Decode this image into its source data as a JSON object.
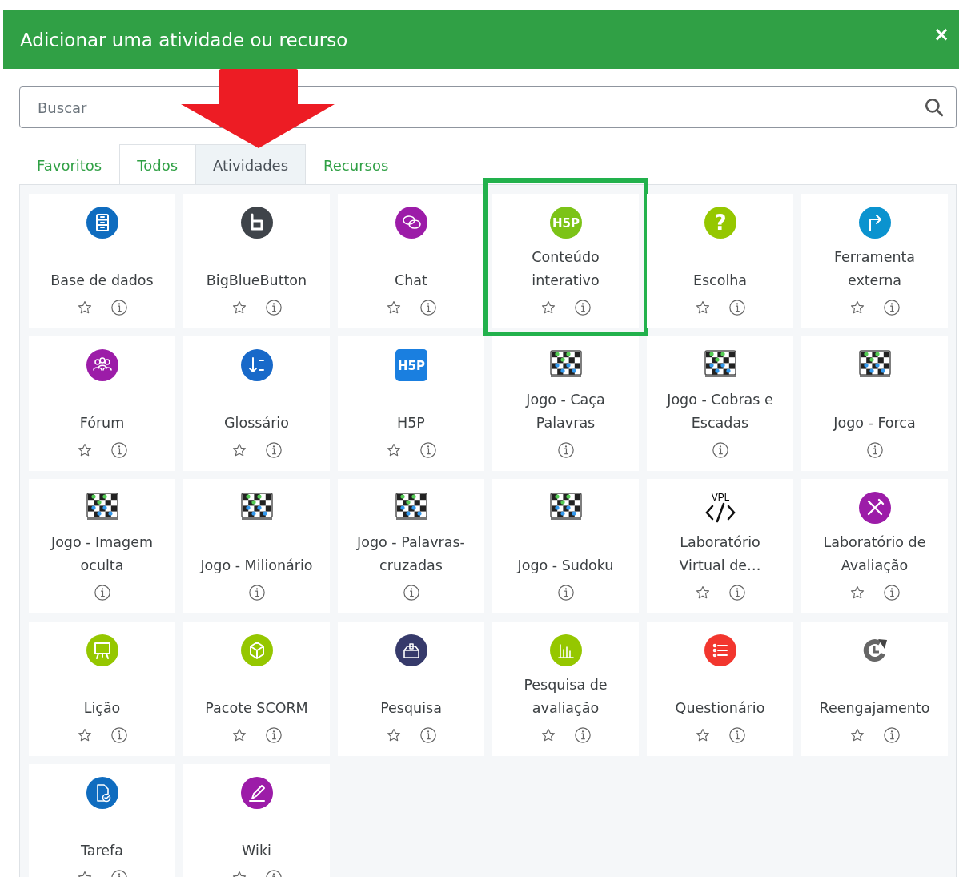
{
  "dialog": {
    "title": "Adicionar uma atividade ou recurso",
    "close": "×"
  },
  "search": {
    "placeholder": "Buscar"
  },
  "tabs": [
    {
      "label": "Favoritos",
      "selected": false,
      "bordered": false
    },
    {
      "label": "Todos",
      "selected": false,
      "bordered": true
    },
    {
      "label": "Atividades",
      "selected": true,
      "bordered": true
    },
    {
      "label": "Recursos",
      "selected": false,
      "bordered": false
    }
  ],
  "items": [
    {
      "name": "Base de dados",
      "kind": "circle",
      "color": "#0f6cbf",
      "star": true,
      "highlighted": false
    },
    {
      "name": "BigBlueButton",
      "kind": "circle",
      "color": "#3f444a",
      "star": true,
      "highlighted": false
    },
    {
      "name": "Chat",
      "kind": "circle",
      "color": "#9c1ca8",
      "star": true,
      "highlighted": false
    },
    {
      "name": "Conteúdo interativo",
      "kind": "circle",
      "icon_text": "H5P",
      "color": "#7cc317",
      "star": true,
      "highlighted": true
    },
    {
      "name": "Escolha",
      "kind": "circle",
      "icon_text": "?",
      "color": "#95c700",
      "star": true,
      "highlighted": false
    },
    {
      "name": "Ferramenta externa",
      "kind": "circle",
      "color": "#0b93cf",
      "star": true,
      "highlighted": false
    },
    {
      "name": "Fórum",
      "kind": "circle",
      "color": "#9c1ca8",
      "star": true,
      "highlighted": false
    },
    {
      "name": "Glossário",
      "kind": "circle",
      "color": "#1869c9",
      "star": true,
      "highlighted": false
    },
    {
      "name": "H5P",
      "kind": "square",
      "icon_text": "H5P",
      "color": "#1a7fe0",
      "star": true,
      "highlighted": false
    },
    {
      "name": "Jogo - Caça Palavras",
      "kind": "board",
      "star": false,
      "highlighted": false
    },
    {
      "name": "Jogo - Cobras e Escadas",
      "kind": "board",
      "star": false,
      "highlighted": false
    },
    {
      "name": "Jogo - Forca",
      "kind": "board",
      "star": false,
      "highlighted": false
    },
    {
      "name": "Jogo - Imagem oculta",
      "kind": "board",
      "star": false,
      "highlighted": false
    },
    {
      "name": "Jogo - Milionário",
      "kind": "board",
      "star": false,
      "highlighted": false
    },
    {
      "name": "Jogo - Palavras-cruzadas",
      "kind": "board",
      "star": false,
      "highlighted": false
    },
    {
      "name": "Jogo - Sudoku",
      "kind": "board",
      "star": false,
      "highlighted": false
    },
    {
      "name": "Laboratório Virtual de…",
      "kind": "code",
      "icon_text": "VPL",
      "star": true,
      "highlighted": false
    },
    {
      "name": "Laboratório de Avaliação",
      "kind": "circle",
      "color": "#9c1ca8",
      "star": true,
      "highlighted": false
    },
    {
      "name": "Lição",
      "kind": "circle",
      "color": "#95c700",
      "star": true,
      "highlighted": false
    },
    {
      "name": "Pacote SCORM",
      "kind": "circle",
      "color": "#95c700",
      "star": true,
      "highlighted": false
    },
    {
      "name": "Pesquisa",
      "kind": "circle",
      "color": "#363a6b",
      "star": true,
      "highlighted": false
    },
    {
      "name": "Pesquisa de avaliação",
      "kind": "circle",
      "color": "#95c700",
      "star": true,
      "highlighted": false
    },
    {
      "name": "Questionário",
      "kind": "circle",
      "color": "#f2362e",
      "star": true,
      "highlighted": false
    },
    {
      "name": "Reengajamento",
      "kind": "refresh",
      "star": true,
      "highlighted": false
    },
    {
      "name": "Tarefa",
      "kind": "circle",
      "color": "#0f6cbf",
      "star": true,
      "highlighted": false
    },
    {
      "name": "Wiki",
      "kind": "circle",
      "color": "#9c1ca8",
      "star": true,
      "highlighted": false
    }
  ]
}
